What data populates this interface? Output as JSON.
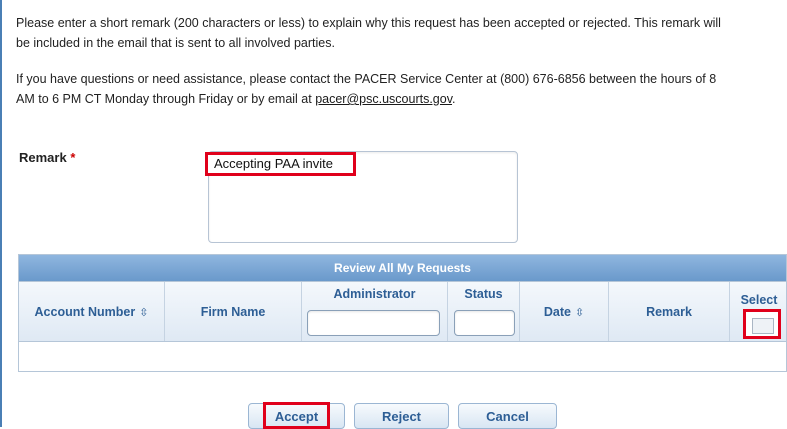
{
  "instructions": {
    "line1": "Please enter a short remark (200 characters or less) to explain why this request has been accepted or rejected. This remark will",
    "line2": "be included in the email that is sent to all involved parties.",
    "contact_line1": "If you have questions or need assistance, please contact the PACER Service Center at (800) 676-6856 between the hours of 8",
    "contact_line2_prefix": "AM to 6 PM CT Monday through Friday or by email at ",
    "email": "pacer@psc.uscourts.gov",
    "contact_line2_suffix": "."
  },
  "remark": {
    "label": "Remark",
    "required_marker": "*",
    "value": "Accepting PAA invite"
  },
  "grid": {
    "title": "Review All My Requests",
    "columns": {
      "account_number": "Account Number",
      "firm_name": "Firm Name",
      "administrator": "Administrator",
      "status": "Status",
      "date": "Date",
      "remark": "Remark",
      "select": "Select"
    },
    "sort_glyph": "⇳"
  },
  "buttons": {
    "accept": "Accept",
    "reject": "Reject",
    "cancel": "Cancel"
  },
  "colors": {
    "highlight": "#e0001b",
    "header_text": "#2d5e95",
    "grid_title_bg": "#7aa5d4"
  }
}
